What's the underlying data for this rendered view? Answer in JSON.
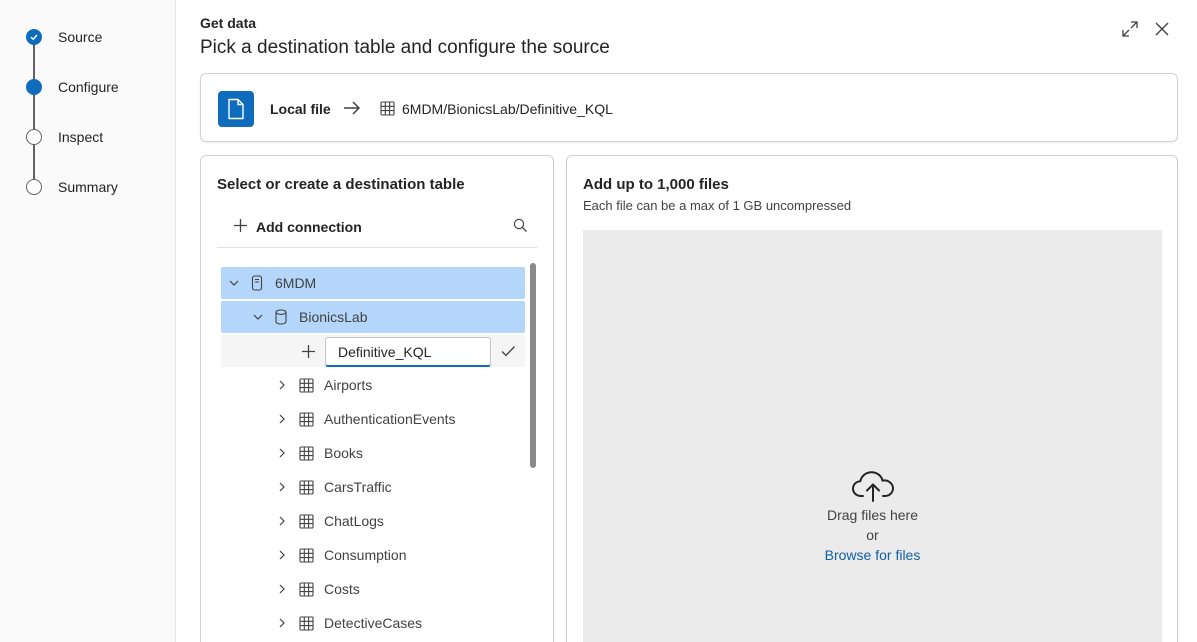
{
  "steps": [
    {
      "label": "Source",
      "state": "done"
    },
    {
      "label": "Configure",
      "state": "active"
    },
    {
      "label": "Inspect",
      "state": "pending"
    },
    {
      "label": "Summary",
      "state": "pending"
    }
  ],
  "header": {
    "small": "Get data",
    "title": "Pick a destination table and configure the source"
  },
  "source": {
    "label": "Local file",
    "destination": "6MDM/BionicsLab/Definitive_KQL"
  },
  "left_panel": {
    "title": "Select or create a destination table",
    "add_connection": "Add connection"
  },
  "tree": {
    "database_server": "6MDM",
    "database": "BionicsLab",
    "new_table_value": "Definitive_KQL",
    "tables": [
      "Airports",
      "AuthenticationEvents",
      "Books",
      "CarsTraffic",
      "ChatLogs",
      "Consumption",
      "Costs",
      "DetectiveCases"
    ]
  },
  "right_panel": {
    "title": "Add up to 1,000 files",
    "subtitle": "Each file can be a max of 1 GB uncompressed",
    "drag_text": "Drag files here",
    "or_text": "or",
    "browse_text": "Browse for files"
  },
  "colors": {
    "accent": "#0f6cbd",
    "selected_row": "#b4d6fa",
    "dropzone": "#ebebeb"
  }
}
